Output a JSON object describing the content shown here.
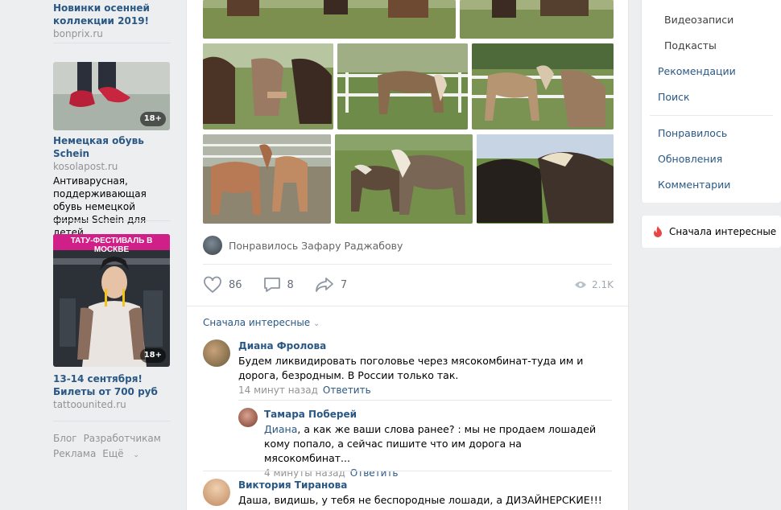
{
  "ads": [
    {
      "title": "Новинки осенней коллекции 2019!",
      "domain": "bonprix.ru"
    },
    {
      "title": "Немецкая обувь Schein",
      "domain": "kosolapost.ru",
      "text": "Антиварусная, поддерживающая обувь немецкой фирмы Schein для детей",
      "badge": "18+"
    },
    {
      "banner": "ТАТУ-ФЕСТИВАЛЬ В МОСКВЕ",
      "title": "13-14 сентября! Билеты от 700 руб",
      "domain": "tattoounited.ru",
      "badge": "18+"
    }
  ],
  "footer": {
    "blog": "Блог",
    "dev": "Разработчикам",
    "ads": "Реклама",
    "more": "Ещё"
  },
  "post": {
    "liked_by": "Понравилось Зафару Раджабову",
    "likes": "86",
    "comments": "8",
    "shares": "7",
    "views": "2.1K",
    "sort_label": "Сначала интересные"
  },
  "comments": [
    {
      "author": "Диана Фролова",
      "text": "Будем ликвидировать поголовье через мясокомбинат-туда им и дорога, безродным. В России только так.",
      "time": "14 минут назад",
      "reply": "Ответить"
    },
    {
      "author": "Тамара Поберей",
      "mention": "Диана",
      "text": ", а как же ваши слова ранее? : мы не продаем лошадей кому попало, а сейчас пишите что им дорога на мясокомбинат...",
      "time": "4 минуты назад",
      "reply": "Ответить"
    },
    {
      "author": "Виктория Тиранова",
      "text": "Даша, видишь, у тебя не беспородные лошади, а ДИЗАЙНЕРСКИЕ!!!"
    }
  ],
  "right_nav": {
    "videos": "Видеозаписи",
    "podcasts": "Подкасты",
    "recommendations": "Рекомендации",
    "search": "Поиск",
    "liked": "Понравилось",
    "updates": "Обновления",
    "comments": "Комментарии",
    "filter": "Сначала интересные"
  },
  "colors": {
    "link": "#2a5885",
    "bg": "#edeef0",
    "tatu": "#d11f8a"
  }
}
